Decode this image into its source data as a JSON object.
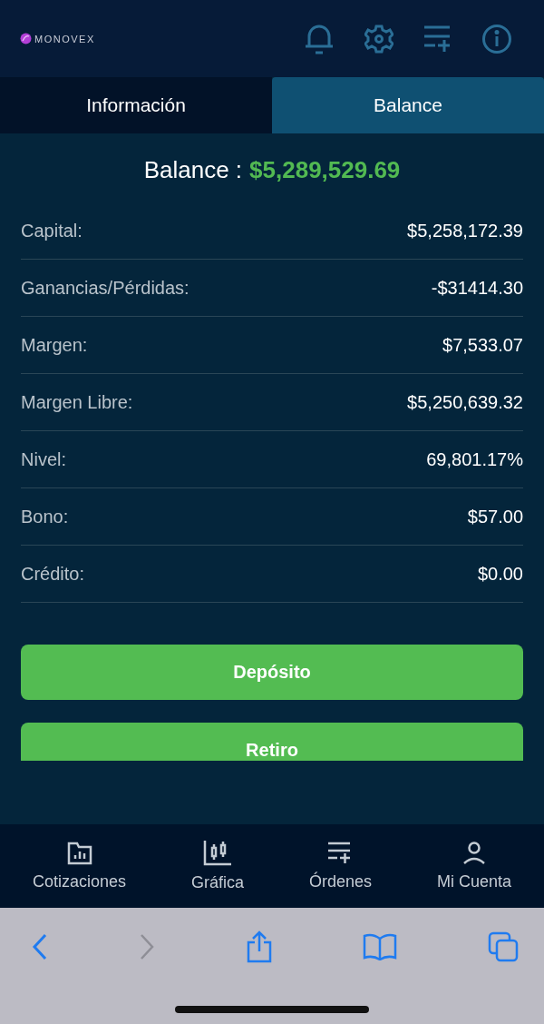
{
  "logo": "MONOVEX",
  "tabs": [
    {
      "label": "Información",
      "selected": false
    },
    {
      "label": "Balance",
      "selected": true
    }
  ],
  "balance": {
    "label": "Balance :",
    "value": "$5,289,529.69"
  },
  "rows": [
    {
      "label": "Capital:",
      "value": "$5,258,172.39"
    },
    {
      "label": "Ganancias/Pérdidas:",
      "value": "-$31414.30"
    },
    {
      "label": "Margen:",
      "value": "$7,533.07"
    },
    {
      "label": "Margen Libre:",
      "value": "$5,250,639.32"
    },
    {
      "label": "Nivel:",
      "value": "69,801.17%"
    },
    {
      "label": "Bono:",
      "value": "$57.00"
    },
    {
      "label": "Crédito:",
      "value": "$0.00"
    }
  ],
  "buttons": [
    "Depósito",
    "Retiro"
  ],
  "nav": [
    {
      "label": "Cotizaciones",
      "kind": "quotes"
    },
    {
      "label": "Gráfica",
      "kind": "chart"
    },
    {
      "label": "Órdenes",
      "kind": "orders"
    },
    {
      "label": "Mi Cuenta",
      "kind": "account"
    }
  ]
}
